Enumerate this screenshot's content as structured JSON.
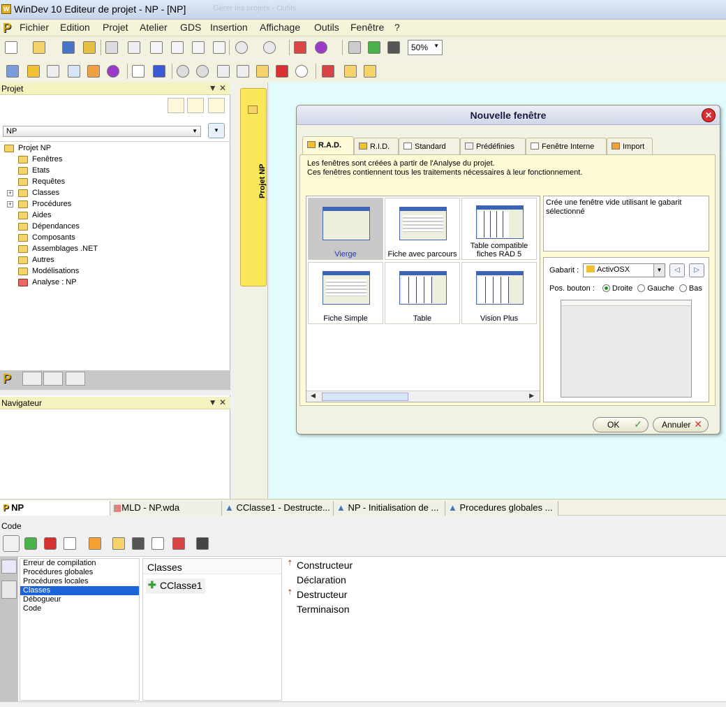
{
  "window": {
    "title": "WinDev 10  Editeur de projet - NP - [NP]",
    "faded_title": "Gérer les projets - Outils"
  },
  "menu": [
    "Fichier",
    "Edition",
    "Projet",
    "Atelier",
    "GDS",
    "Insertion",
    "Affichage",
    "Outils",
    "Fenêtre",
    "?"
  ],
  "toolbar": {
    "zoom": "50%"
  },
  "project_panel": {
    "title": "Projet",
    "combo_value": "NP",
    "tree": [
      {
        "label": "Projet NP",
        "level": 0,
        "icon": "folder-icon"
      },
      {
        "label": "Fenêtres",
        "level": 1,
        "icon": "folder-icon"
      },
      {
        "label": "Etats",
        "level": 1,
        "icon": "folder-icon"
      },
      {
        "label": "Requêtes",
        "level": 1,
        "icon": "folder-icon"
      },
      {
        "label": "Classes",
        "level": 1,
        "icon": "folder-icon",
        "expandable": true
      },
      {
        "label": "Procédures",
        "level": 1,
        "icon": "folder-icon",
        "expandable": true
      },
      {
        "label": "Aides",
        "level": 1,
        "icon": "folder-icon"
      },
      {
        "label": "Dépendances",
        "level": 1,
        "icon": "folder-icon"
      },
      {
        "label": "Composants",
        "level": 1,
        "icon": "folder-icon"
      },
      {
        "label": "Assemblages .NET",
        "level": 1,
        "icon": "folder-icon"
      },
      {
        "label": "Autres",
        "level": 1,
        "icon": "folder-icon"
      },
      {
        "label": "Modélisations",
        "level": 1,
        "icon": "folder-icon"
      },
      {
        "label": "Analyse : NP",
        "level": 1,
        "icon": "analysis-icon"
      }
    ]
  },
  "navigator_panel": {
    "title": "Navigateur"
  },
  "vertical_tab": {
    "label": "Projet NP"
  },
  "dialog": {
    "title": "Nouvelle fenêtre",
    "tabs": [
      "R.A.D.",
      "R.I.D.",
      "Standard",
      "Prédéfinies",
      "Fenêtre Interne",
      "Import"
    ],
    "active_tab": "R.A.D.",
    "description_line1": "Les fenêtres sont créées à partir de l'Analyse du projet.",
    "description_line2": "Ces fenêtres contiennent tous les traitements nécessaires à leur fonctionnement.",
    "gallery": [
      "Vierge",
      "Fiche avec parcours",
      "Table compatible fiches RAD 5",
      "Fiche Simple",
      "Table",
      "Vision Plus"
    ],
    "selected_item": "Vierge",
    "info_text": "Crée une fenêtre vide utilisant le gabarit sélectionné",
    "gabarit_label": "Gabarit :",
    "gabarit_value": "ActivOSX",
    "pos_label": "Pos. bouton :",
    "pos_options": [
      "Droite",
      "Gauche",
      "Bas"
    ],
    "pos_selected": "Droite",
    "ok_label": "OK",
    "cancel_label": "Annuler"
  },
  "doc_tabs": [
    "NP",
    "MLD - NP.wda",
    "CClasse1 - Destructe...",
    "NP - Initialisation de ...",
    "Procedures globales ..."
  ],
  "code": {
    "title": "Code",
    "list": [
      "Erreur de compilation",
      "Procédures globales",
      "Procédures locales",
      "Classes",
      "Débogueur",
      "Code"
    ],
    "selected": "Classes",
    "classes_header": "Classes",
    "class_item": "CClasse1",
    "methods": [
      "Constructeur",
      "Déclaration",
      "Destructeur",
      "Terminaison"
    ]
  },
  "colors": {
    "accent_yellow": "#f3f2c0",
    "work_area": "#e2fbfd",
    "selection_blue": "#1a64d8"
  }
}
